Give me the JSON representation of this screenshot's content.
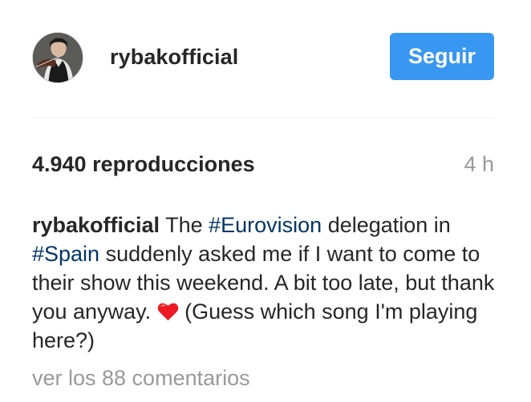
{
  "post": {
    "author": {
      "username": "rybakofficial",
      "avatar_icon": "profile-photo-violinist"
    },
    "follow_button_label": "Seguir",
    "views_text": "4.940 reproducciones",
    "time_ago": "4 h",
    "caption": {
      "author": "rybakofficial",
      "part1": " The ",
      "hashtag1": "#Eurovision",
      "part2": " delegation in ",
      "hashtag2": "#Spain",
      "part3": " suddenly asked me if I want to come to their show this weekend. A bit too late, but thank you anyway. ",
      "emoji_icon": "red-heart-icon",
      "part4": " (Guess which song I'm playing here?)"
    },
    "view_comments_text": "ver los 88 comentarios"
  },
  "colors": {
    "accent": "#3897f0",
    "hashtag": "#003569",
    "muted": "#999999",
    "text": "#262626",
    "heart": "#ed1c24"
  }
}
